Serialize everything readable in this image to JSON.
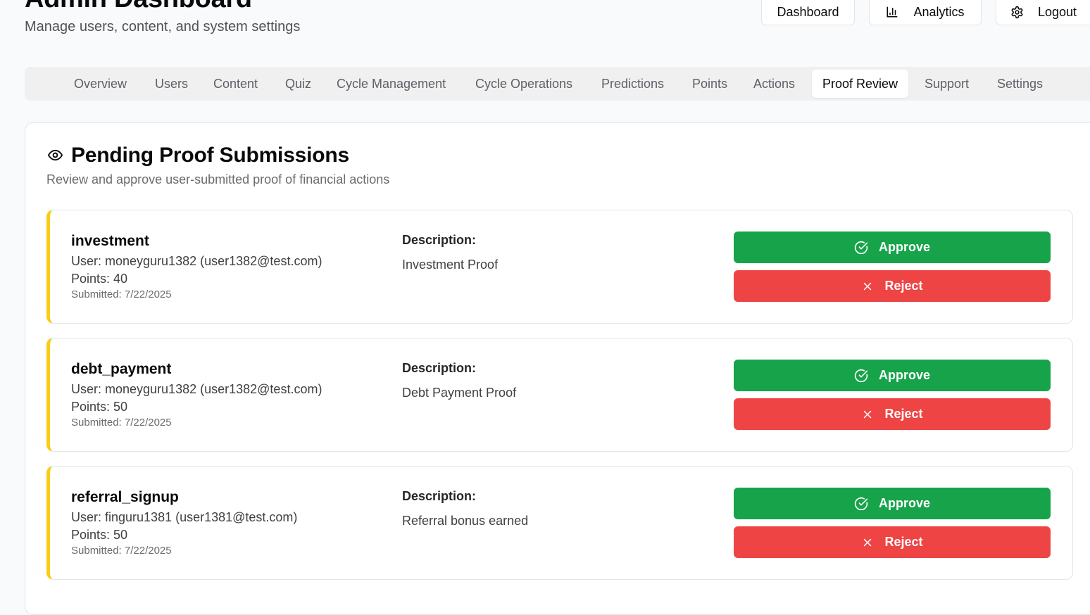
{
  "header": {
    "title": "Admin Dashboard",
    "subtitle": "Manage users, content, and system settings",
    "buttons": {
      "dashboard": "Dashboard",
      "analytics": "Analytics",
      "logout": "Logout"
    }
  },
  "tabs": [
    {
      "label": "Overview"
    },
    {
      "label": "Users"
    },
    {
      "label": "Content"
    },
    {
      "label": "Quiz"
    },
    {
      "label": "Cycle Management"
    },
    {
      "label": "Cycle Operations"
    },
    {
      "label": "Predictions"
    },
    {
      "label": "Points"
    },
    {
      "label": "Actions"
    },
    {
      "label": "Proof Review",
      "active": true
    },
    {
      "label": "Support"
    },
    {
      "label": "Settings"
    }
  ],
  "panel": {
    "icon": "eye-icon",
    "title": "Pending Proof Submissions",
    "description": "Review and approve user-submitted proof of financial actions",
    "description_label": "Description:",
    "approve_label": "Approve",
    "reject_label": "Reject"
  },
  "submissions": [
    {
      "type": "investment",
      "user": "User: moneyguru1382 (user1382@test.com)",
      "points": "Points: 40",
      "submitted": "Submitted: 7/22/2025",
      "description": "Investment Proof"
    },
    {
      "type": "debt_payment",
      "user": "User: moneyguru1382 (user1382@test.com)",
      "points": "Points: 50",
      "submitted": "Submitted: 7/22/2025",
      "description": "Debt Payment Proof"
    },
    {
      "type": "referral_signup",
      "user": "User: finguru1381 (user1381@test.com)",
      "points": "Points: 50",
      "submitted": "Submitted: 7/22/2025",
      "description": "Referral bonus earned"
    }
  ],
  "colors": {
    "approve": "#16a34a",
    "reject": "#ef4444",
    "pending_accent": "#facc15",
    "tab_bar": "#f0f0f1"
  }
}
